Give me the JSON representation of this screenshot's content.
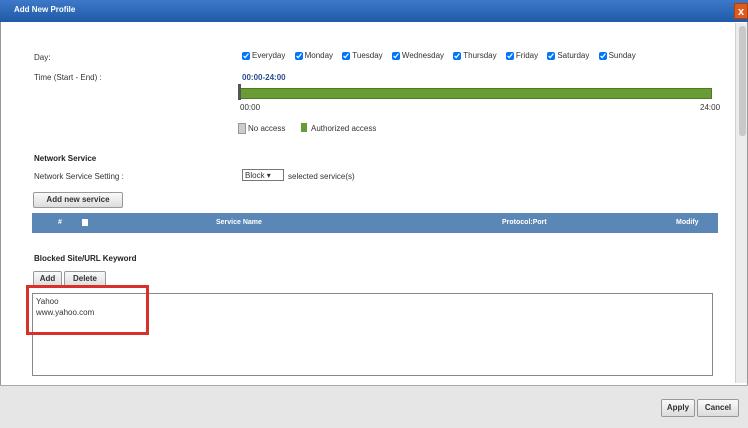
{
  "window": {
    "title": "Add New Profile",
    "close": "x"
  },
  "schedule": {
    "day_label": "Day:",
    "days": [
      "Everyday",
      "Monday",
      "Tuesday",
      "Wednesday",
      "Thursday",
      "Friday",
      "Saturday",
      "Sunday"
    ],
    "time_label": "Time (Start - End) :",
    "time_value": "00:00-24:00",
    "axis_start": "00:00",
    "axis_end": "24:00",
    "legend_no_access": "No access",
    "legend_authorized": "Authorized access",
    "authorized_fraction": 1.0
  },
  "network_service": {
    "heading": "Network Service",
    "setting_label": "Network Service Setting :",
    "setting_value": "Block",
    "setting_suffix": "selected service(s)",
    "add_button": "Add new service",
    "table_headers": [
      "#",
      "Service Name",
      "Protocol:Port",
      "Modify"
    ]
  },
  "blocked": {
    "heading": "Blocked Site/URL Keyword",
    "add_button": "Add",
    "delete_button": "Delete",
    "keywords": [
      "Yahoo",
      "www.yahoo.com"
    ]
  },
  "footer": {
    "apply": "Apply",
    "cancel": "Cancel"
  },
  "colors": {
    "title_bar": "#2d67b6",
    "accent_green": "#6a9c36",
    "table_header": "#5b87b6",
    "highlight": "#d9302a"
  }
}
